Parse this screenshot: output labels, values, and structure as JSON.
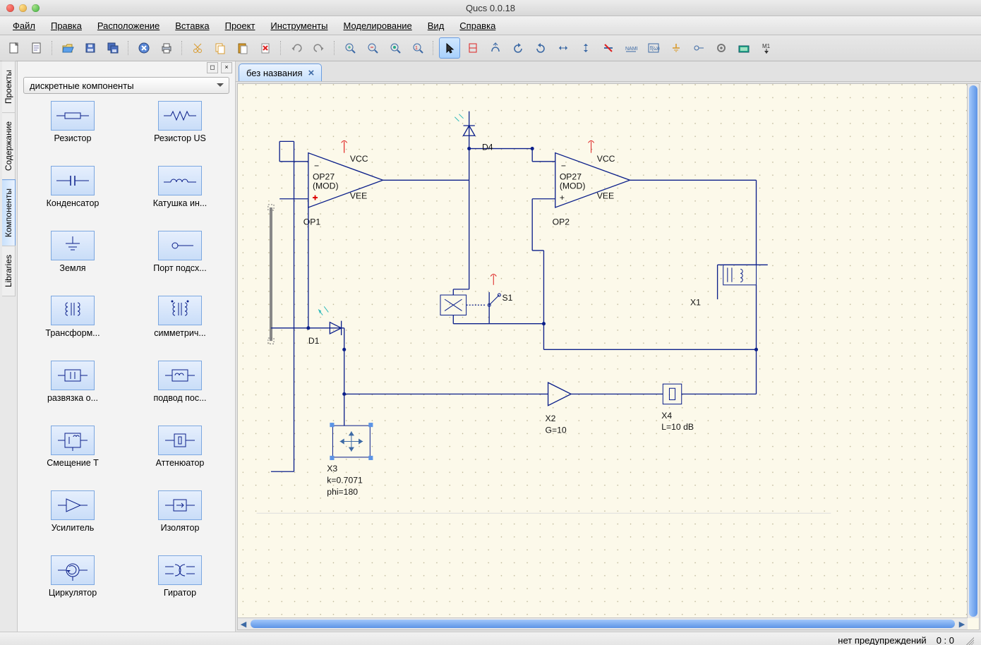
{
  "app_title": "Qucs 0.0.18",
  "menu": [
    "Файл",
    "Правка",
    "Расположение",
    "Вставка",
    "Проект",
    "Инструменты",
    "Моделирование",
    "Вид",
    "Справка"
  ],
  "toolbar_icons": [
    "new-file",
    "new-text",
    "sep",
    "open",
    "save",
    "save-all",
    "sep",
    "close",
    "print",
    "sep",
    "cut",
    "copy",
    "paste",
    "delete",
    "sep",
    "undo",
    "redo",
    "sep",
    "zoom-in",
    "zoom-out",
    "zoom-fit",
    "zoom-100",
    "sep",
    "pointer",
    "wire",
    "label",
    "rotate-ccw",
    "rotate-cw",
    "mirror-h",
    "mirror-v",
    "align-left",
    "name-tool",
    "equation",
    "ground",
    "port",
    "settings",
    "simulate",
    "marker"
  ],
  "doc_tab": {
    "label": "без названия"
  },
  "side_tabs": [
    "Проекты",
    "Содержание",
    "Компоненты",
    "Libraries"
  ],
  "active_side_tab": 2,
  "combo_label": "дискретные компоненты",
  "components": [
    "Резистор",
    "Резистор US",
    "Конденсатор",
    "Катушка ин...",
    "Земля",
    "Порт подсх...",
    "Трансформ...",
    "симметрич...",
    "развязка о...",
    "подвод пос...",
    "Смещение Т",
    "Аттенюатор",
    "Усилитель",
    "Изолятор",
    "Циркулятор",
    "Гиратор"
  ],
  "schematic": {
    "labels": {
      "OP1": "OP1",
      "OP2": "OP2",
      "VCC": "VCC",
      "VEE": "VEE",
      "OP27a": "OP27",
      "OP27b": "(MOD)",
      "D1": "D1",
      "D4": "D4",
      "S1": "S1",
      "X1": "X1",
      "X2a": "X2",
      "X2b": "G=10",
      "X3a": "X3",
      "X3b": "k=0.7071",
      "X3c": "phi=180",
      "X4a": "X4",
      "X4b": "L=10 dB"
    }
  },
  "status": {
    "warn": "нет предупреждений",
    "coords": "0 : 0"
  }
}
